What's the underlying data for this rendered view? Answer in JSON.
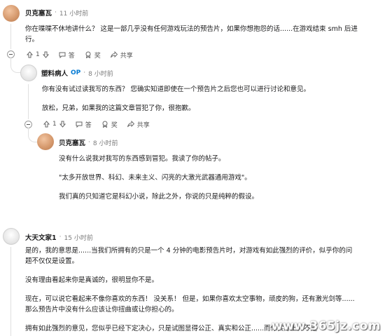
{
  "comments": [
    {
      "username": "贝克塞瓦",
      "time": "11 小时前",
      "lines": [
        "你在喋喋不休地讲什么？ 这是一部几乎没有任何游戏玩法的预告片，如果你想抱怨的话......在游戏结束 smh 后进",
        "行。"
      ],
      "votes": "1",
      "reply": "答",
      "award": "奖",
      "share": "共享"
    },
    {
      "username": "塑料病人",
      "op_badge": "OP",
      "time": "8 小时前",
      "paragraphs": [
        "你有没有试过读我写的东西？ 您确实知道即使在一个预告片之后您也可以进行讨论和意见。",
        "放松，兄弟，如果我的这篇文章冒犯了你，很抱歉。"
      ],
      "votes": "1",
      "reply": "答",
      "award": "奖",
      "share": "共享"
    },
    {
      "username": "贝克塞瓦",
      "time": "8 小时前",
      "paragraphs": [
        "没有什么说我对我写的东西感到冒犯。我读了你的帖子。",
        "\"太多开放世界、科幻、未来主义、闪亮的大激光武器通用游戏\"。",
        "我们真的只知道它是科幻小说，除此之外，你说的只是纯粹的假设。"
      ]
    },
    {
      "username": "大天文家1",
      "time": "15 小时前",
      "paragraphs": [
        [
          "是的，我的意思是......当我们所拥有的只是一个 4 分钟的电影预告片时，对游戏有如此强烈的评价，似乎你的问",
          "题不仅仅是设置。"
        ],
        [
          "没有理由看起来你是真诚的，很明显你不是。"
        ],
        [
          "现在，可以说它看起来不像你喜欢的东西！ 没关系！ 但是，如果你喜欢太空事物，顽皮的狗，还有激光剑等......",
          "那么预告片中没有什么应该让你扭曲或让你担心的。"
        ],
        [
          "拥有如此强烈的意见，您似乎已经下定决心，只是试图显得公正、真实和公正......而你实际上并不是"
        ]
      ]
    }
  ],
  "watermark": "www.365jz.com",
  "icons": [
    "upvote-icon",
    "downvote-icon",
    "comment-icon",
    "award-icon",
    "share-icon",
    "collapse-icon"
  ]
}
